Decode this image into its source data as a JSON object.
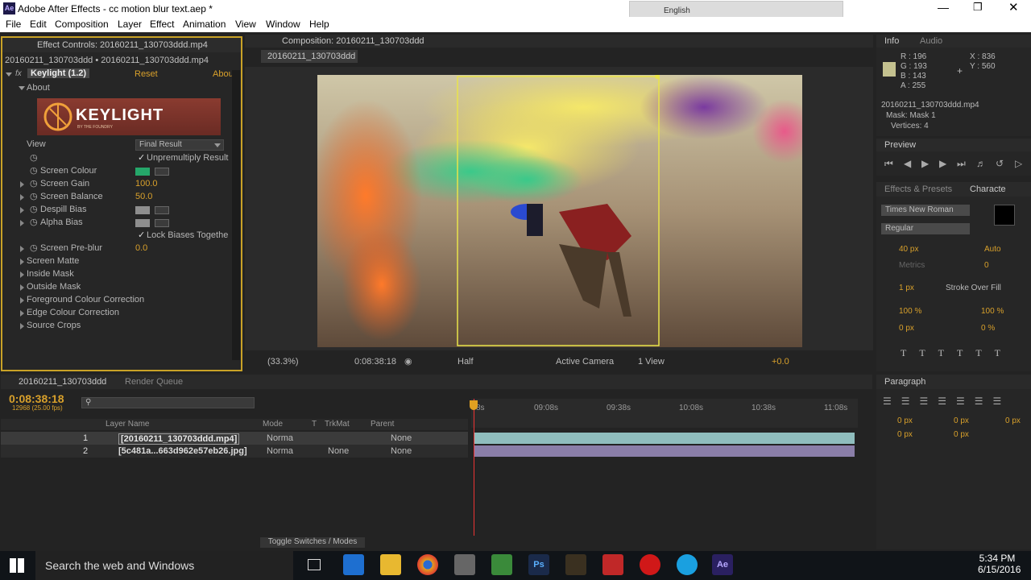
{
  "window": {
    "title": "Adobe After Effects - cc motion blur text.aep *",
    "app_icon": "Ae",
    "lang": "English"
  },
  "menu": [
    "File",
    "Edit",
    "Composition",
    "Layer",
    "Effect",
    "Animation",
    "View",
    "Window",
    "Help"
  ],
  "effect_controls": {
    "tab": "Effect Controls: 20160211_130703ddd.mp4",
    "breadcrumb": "20160211_130703ddd • 20160211_130703ddd.mp4",
    "effect_name": "Keylight (1.2)",
    "reset": "Reset",
    "about_link": "Abou",
    "about_label": "About",
    "logo_text": "KEYLIGHT",
    "logo_sub": "BY THE FOUNDRY",
    "view_label": "View",
    "view_value": "Final Result",
    "unpremultiply": "Unpremultiply Result",
    "screen_colour": "Screen Colour",
    "screen_gain": "Screen Gain",
    "screen_gain_val": "100.0",
    "screen_balance": "Screen Balance",
    "screen_balance_val": "50.0",
    "despill_bias": "Despill Bias",
    "alpha_bias": "Alpha Bias",
    "lock_biases": "Lock Biases Togethe",
    "screen_preblur": "Screen Pre-blur",
    "screen_preblur_val": "0.0",
    "sections": [
      "Screen Matte",
      "Inside Mask",
      "Outside Mask",
      "Foreground Colour Correction",
      "Edge Colour Correction",
      "Source Crops"
    ]
  },
  "composition": {
    "tab": "Composition: 20160211_130703ddd",
    "subtab": "20160211_130703ddd",
    "zoom": "(33.3%)",
    "timecode": "0:08:38:18",
    "resolution": "Half",
    "camera": "Active Camera",
    "views": "1 View",
    "exposure": "+0.0"
  },
  "info": {
    "tab_info": "Info",
    "tab_audio": "Audio",
    "r": "R : 196",
    "g": "G : 193",
    "b": "B : 143",
    "a": "A : 255",
    "x": "X : 836",
    "y": "Y : 560",
    "file": "20160211_130703ddd.mp4",
    "mask": "Mask: Mask 1",
    "vertices": "Vertices: 4",
    "swatch_color": "#c4c18f"
  },
  "preview": {
    "tab": "Preview"
  },
  "character": {
    "tab_effects": "Effects & Presets",
    "tab_char": "Characte",
    "font": "Times New Roman",
    "style": "Regular",
    "size": "40 px",
    "leading": "Auto",
    "kerning": "Metrics",
    "tracking": "0",
    "stroke": "1 px",
    "stroke_mode": "Stroke Over Fill",
    "vscale": "100 %",
    "hscale": "100 %",
    "baseline": "0 px",
    "tsume": "0 %"
  },
  "paragraph": {
    "tab": "Paragraph",
    "indent_left": "0 px",
    "indent_right": "0 px",
    "indent_first": "0 px",
    "space_before": "0 px",
    "space_after": "0 px"
  },
  "timeline": {
    "tab": "20160211_130703ddd",
    "tab2": "Render Queue",
    "timecode": "0:08:38:18",
    "frames": "12968 (25.00 fps)",
    "col_layer": "Layer Name",
    "col_mode": "Mode",
    "col_t": "T",
    "col_trkmat": "TrkMat",
    "col_parent": "Parent",
    "ruler": [
      "8s",
      "09:08s",
      "09:38s",
      "10:08s",
      "10:38s",
      "11:08s"
    ],
    "layers": [
      {
        "num": "1",
        "name": "[20160211_130703ddd.mp4]",
        "mode": "Norma",
        "trkmat": "",
        "parent": "None"
      },
      {
        "num": "2",
        "name": "[5c481a...663d962e57eb26.jpg]",
        "mode": "Norma",
        "trkmat": "None",
        "parent": "None"
      }
    ],
    "toggle": "Toggle Switches / Modes"
  },
  "taskbar": {
    "search": "Search the web and Windows",
    "time": "5:34 PM",
    "date": "6/15/2016"
  }
}
